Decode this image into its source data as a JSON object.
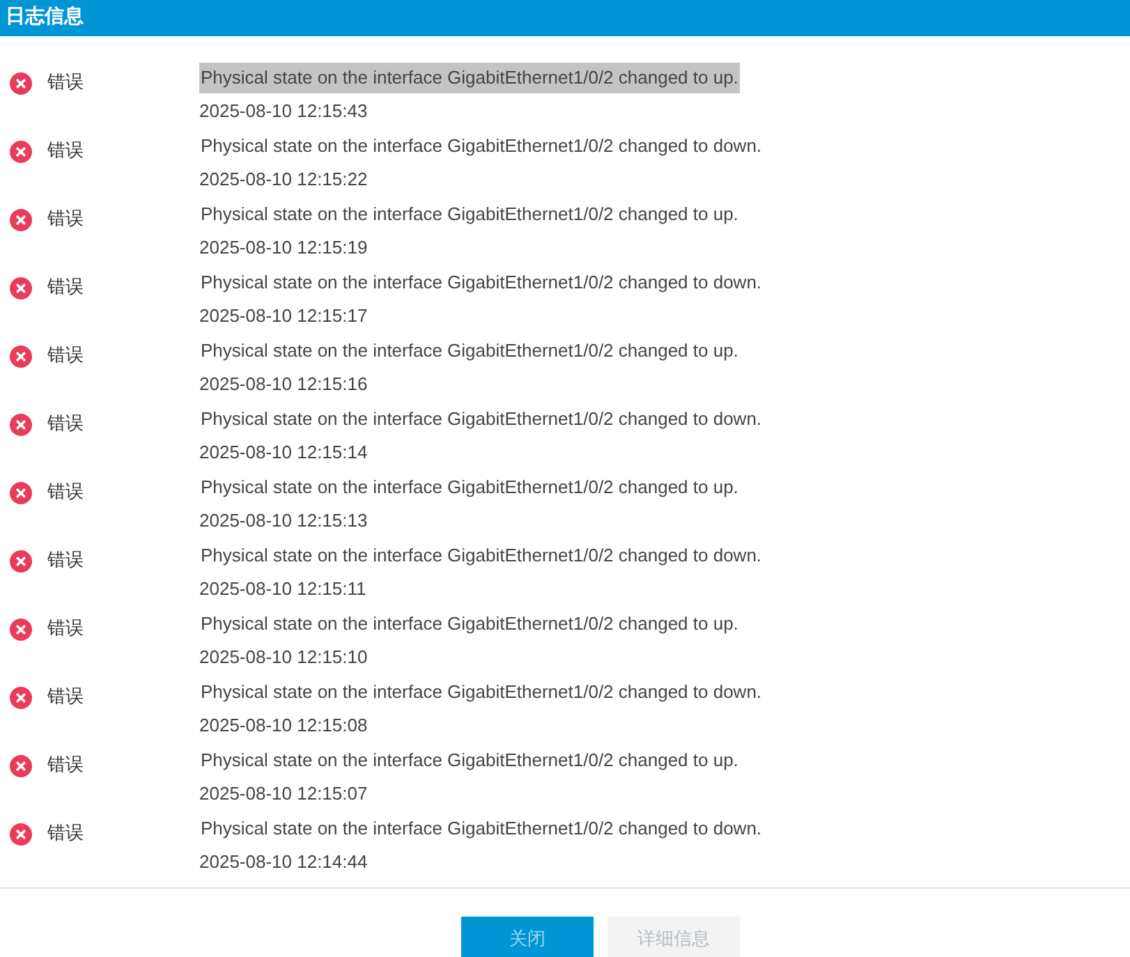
{
  "window": {
    "title": "日志信息"
  },
  "logs": [
    {
      "level": "错误",
      "message": "Physical state on the interface GigabitEthernet1/0/2 changed to up.",
      "time": "2025-08-10 12:15:43",
      "selected": true
    },
    {
      "level": "错误",
      "message": "Physical state on the interface GigabitEthernet1/0/2 changed to down.",
      "time": "2025-08-10 12:15:22",
      "selected": false
    },
    {
      "level": "错误",
      "message": "Physical state on the interface GigabitEthernet1/0/2 changed to up.",
      "time": "2025-08-10 12:15:19",
      "selected": false
    },
    {
      "level": "错误",
      "message": "Physical state on the interface GigabitEthernet1/0/2 changed to down.",
      "time": "2025-08-10 12:15:17",
      "selected": false
    },
    {
      "level": "错误",
      "message": "Physical state on the interface GigabitEthernet1/0/2 changed to up.",
      "time": "2025-08-10 12:15:16",
      "selected": false
    },
    {
      "level": "错误",
      "message": "Physical state on the interface GigabitEthernet1/0/2 changed to down.",
      "time": "2025-08-10 12:15:14",
      "selected": false
    },
    {
      "level": "错误",
      "message": "Physical state on the interface GigabitEthernet1/0/2 changed to up.",
      "time": "2025-08-10 12:15:13",
      "selected": false
    },
    {
      "level": "错误",
      "message": "Physical state on the interface GigabitEthernet1/0/2 changed to down.",
      "time": "2025-08-10 12:15:11",
      "selected": false
    },
    {
      "level": "错误",
      "message": "Physical state on the interface GigabitEthernet1/0/2 changed to up.",
      "time": "2025-08-10 12:15:10",
      "selected": false
    },
    {
      "level": "错误",
      "message": "Physical state on the interface GigabitEthernet1/0/2 changed to down.",
      "time": "2025-08-10 12:15:08",
      "selected": false
    },
    {
      "level": "错误",
      "message": "Physical state on the interface GigabitEthernet1/0/2 changed to up.",
      "time": "2025-08-10 12:15:07",
      "selected": false
    },
    {
      "level": "错误",
      "message": "Physical state on the interface GigabitEthernet1/0/2 changed to down.",
      "time": "2025-08-10 12:14:44",
      "selected": false
    }
  ],
  "buttons": [
    {
      "label": "关闭",
      "kind": "primary",
      "disabled": false
    },
    {
      "label": "详细信息",
      "kind": "secondary",
      "disabled": true
    }
  ]
}
